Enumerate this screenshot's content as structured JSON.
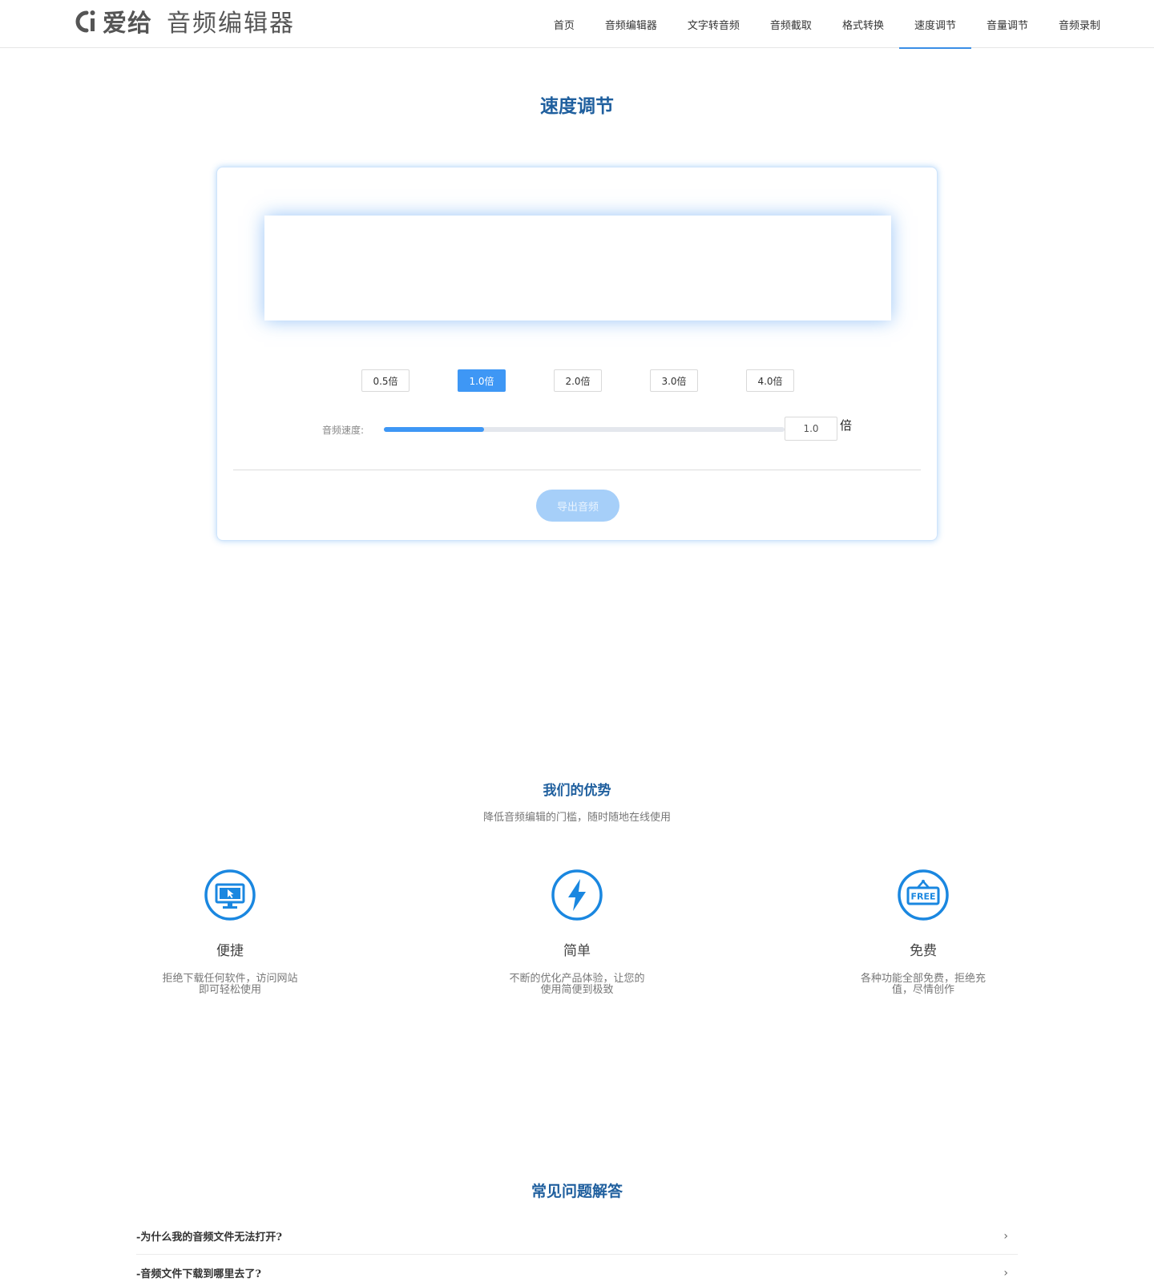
{
  "header": {
    "logo_text": "爱给",
    "logo_subtitle": "音频编辑器",
    "nav": [
      {
        "label": "首页",
        "active": false
      },
      {
        "label": "音频编辑器",
        "active": false
      },
      {
        "label": "文字转音频",
        "active": false
      },
      {
        "label": "音频截取",
        "active": false
      },
      {
        "label": "格式转换",
        "active": false
      },
      {
        "label": "速度调节",
        "active": true
      },
      {
        "label": "音量调节",
        "active": false
      },
      {
        "label": "音频录制",
        "active": false
      }
    ]
  },
  "main": {
    "title": "速度调节",
    "speed_options": [
      "0.5倍",
      "1.0倍",
      "2.0倍",
      "3.0倍",
      "4.0倍"
    ],
    "selected_speed_index": 1,
    "speed_label": "音频速度:",
    "speed_value": "1.0",
    "speed_unit": "倍",
    "slider_fraction": 0.25,
    "export_label": "导出音频",
    "accent_color": "#3e97f5"
  },
  "advantages": {
    "title": "我们的优势",
    "subtitle": "降低音频编辑的门槛，随时随地在线使用",
    "items": [
      {
        "icon": "monitor-cursor-icon",
        "title": "便捷",
        "desc": "拒绝下载任何软件，访问网站即可轻松使用"
      },
      {
        "icon": "lightning-icon",
        "title": "简单",
        "desc": "不断的优化产品体验，让您的使用简便到极致"
      },
      {
        "icon": "free-sign-icon",
        "icon_text": "FREE",
        "title": "免费",
        "desc": "各种功能全部免费，拒绝充值，尽情创作"
      }
    ]
  },
  "faq": {
    "title": "常见问题解答",
    "items": [
      {
        "question": "-为什么我的音频文件无法打开?"
      },
      {
        "question": "-音频文件下载到哪里去了?"
      }
    ]
  }
}
